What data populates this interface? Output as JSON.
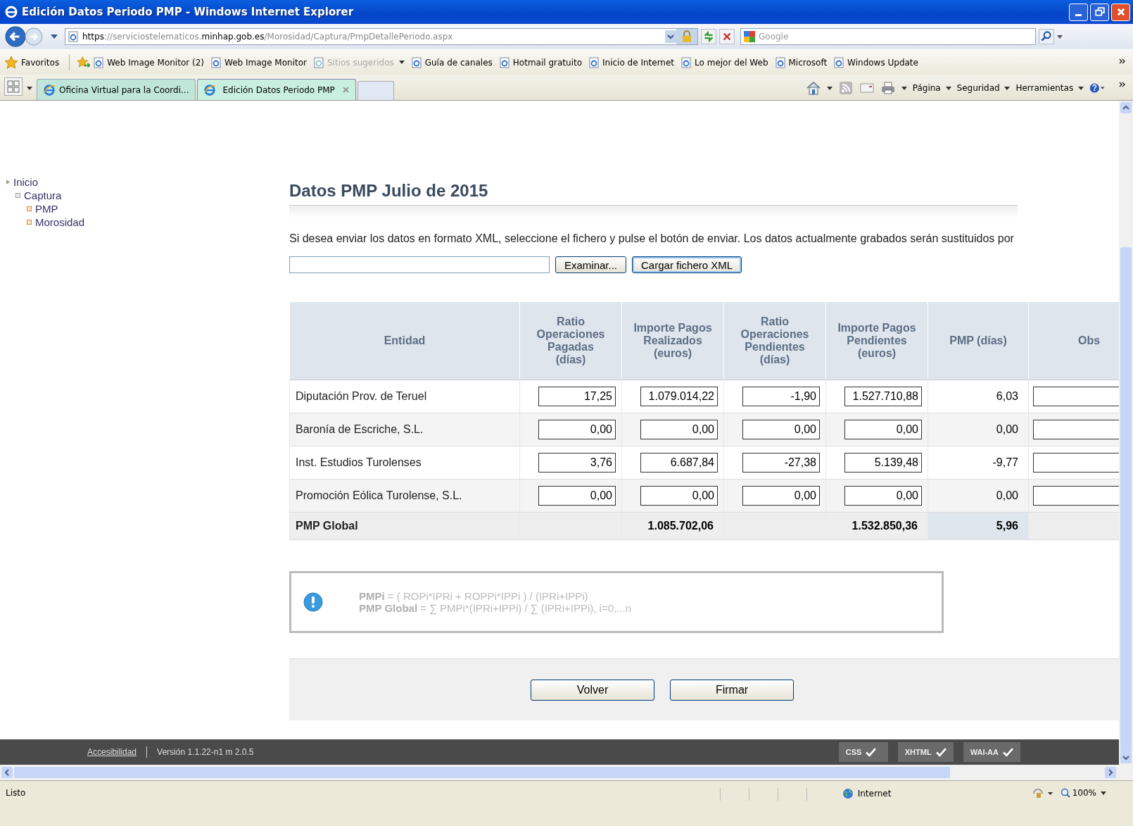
{
  "window": {
    "title": "Edición Datos Periodo PMP - Windows Internet Explorer"
  },
  "address_bar": {
    "scheme": "https",
    "separator": "://",
    "subdomain": "serviciostelematicos.",
    "domain": "minhap.gob.es",
    "path": "/Morosidad/Captura/PmpDetallePeriodo.aspx"
  },
  "search": {
    "placeholder": "Google"
  },
  "favorites_bar": {
    "label": "Favoritos",
    "items": [
      {
        "label": "Web Image Monitor (2)",
        "disabled": false,
        "dropdown": false
      },
      {
        "label": "Web Image Monitor",
        "disabled": false,
        "dropdown": false
      },
      {
        "label": "Sitios sugeridos",
        "disabled": true,
        "dropdown": true
      },
      {
        "label": "Guía de canales",
        "disabled": false,
        "dropdown": false
      },
      {
        "label": "Hotmail gratuito",
        "disabled": false,
        "dropdown": false
      },
      {
        "label": "Inicio de Internet",
        "disabled": false,
        "dropdown": false
      },
      {
        "label": "Lo mejor del Web",
        "disabled": false,
        "dropdown": false
      },
      {
        "label": "Microsoft",
        "disabled": false,
        "dropdown": false
      },
      {
        "label": "Windows Update",
        "disabled": false,
        "dropdown": false
      }
    ]
  },
  "tabs": [
    {
      "label": "Oficina Virtual para la Coordi...",
      "selected": false
    },
    {
      "label": "Edición Datos Periodo PMP",
      "selected": true
    }
  ],
  "command_bar": [
    "Página",
    "Seguridad",
    "Herramientas"
  ],
  "sidebar": {
    "tree": [
      {
        "label": "Inicio",
        "children": [
          {
            "label": "Captura",
            "children": [
              {
                "label": "PMP"
              },
              {
                "label": "Morosidad"
              }
            ]
          }
        ]
      }
    ]
  },
  "page": {
    "heading": "Datos PMP Julio de 2015",
    "instructions": "Si desea enviar los datos en formato XML, seleccione el fichero y pulse el botón de enviar. Los datos actualmente grabados serán sustituidos por",
    "browse_button": "Examinar...",
    "upload_button": "Cargar fichero XML",
    "table": {
      "columns": [
        "Entidad",
        "Ratio Operaciones Pagadas (días)",
        "Importe Pagos Realizados (euros)",
        "Ratio Operaciones Pendientes (días)",
        "Importe Pagos Pendientes (euros)",
        "PMP (días)",
        "Obs"
      ],
      "rows": [
        {
          "entity": "Diputación Prov. de Teruel",
          "values": [
            "17,25",
            "1.079.014,22",
            "-1,90",
            "1.527.710,88"
          ],
          "pmp": "6,03"
        },
        {
          "entity": "Baronía de Escriche, S.L.",
          "values": [
            "0,00",
            "0,00",
            "0,00",
            "0,00"
          ],
          "pmp": "0,00"
        },
        {
          "entity": "Inst. Estudios Turolenses",
          "values": [
            "3,76",
            "6.687,84",
            "-27,38",
            "5.139,48"
          ],
          "pmp": "-9,77"
        },
        {
          "entity": "Promoción Eólica Turolense, S.L.",
          "values": [
            "0,00",
            "0,00",
            "0,00",
            "0,00"
          ],
          "pmp": "0,00"
        }
      ],
      "total": {
        "label": "PMP Global",
        "payments_made": "1.085.702,06",
        "payments_pending": "1.532.850,36",
        "pmp": "5,96"
      }
    },
    "formula": [
      {
        "term": "PMPi",
        "expr": "= ( ROPi*IPRi + ROPPi*IPPi ) / (IPRi+IPPi)"
      },
      {
        "term": "PMP Global",
        "expr": "= ∑ PMPi*(IPRi+IPPi) / ∑ (IPRi+IPPi), i=0,...n"
      }
    ],
    "actions": [
      "Volver",
      "Firmar"
    ]
  },
  "footer": {
    "link": "Accesibilidad",
    "version": "Versión 1.1.22-n1 m 2.0.5",
    "badges": [
      "CSS",
      "XHTML",
      "WAI-AA"
    ]
  },
  "status_bar": {
    "text": "Listo",
    "zone": "Internet",
    "zoom": "100%"
  }
}
